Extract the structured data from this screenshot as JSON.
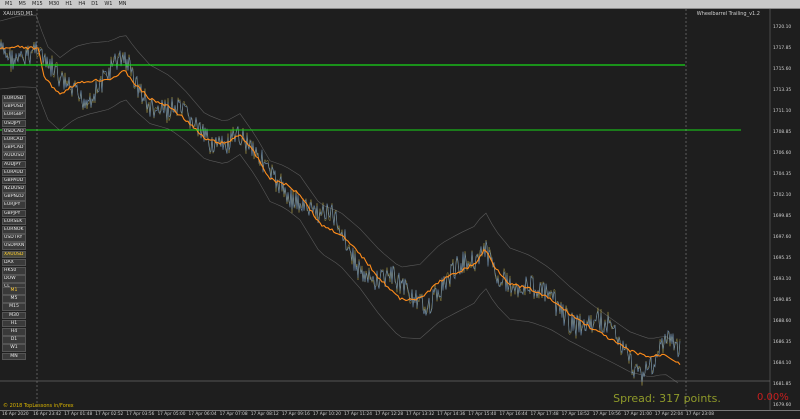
{
  "toolbar": {
    "timeframes": [
      "M1",
      "M5",
      "M15",
      "M30",
      "H1",
      "H4",
      "D1",
      "W1",
      "MN"
    ]
  },
  "chart": {
    "symbol_label": "XAUUSD,M1",
    "indicator_label": "Wheelbarrel Trailing_v1.2",
    "copyright": "© 2018 TopLessons in/Forex",
    "spread_text": "Spread: 317 points.",
    "spread_pct": "0.00%",
    "colors": {
      "background": "#1e1e1e",
      "price_line": "#6f8fb0",
      "price_line_alt": "#b8a84a",
      "trailing_line": "#ff8c1a",
      "band_line": "#5a5a5a",
      "level_line": "#18d818",
      "active_symbol": "#ffcc33"
    }
  },
  "symbols": [
    "EURUSD",
    "GBPUSD",
    "EURGBP",
    "USDJPY",
    "USDCAD",
    "EURCAD",
    "GBPCAD",
    "AUDUSD",
    "AUDJPY",
    "EURAUD",
    "GBPAUD",
    "NZDUSD",
    "GBPNZD",
    "EURJPY",
    "GBPJPY",
    "EURSEK",
    "EURNOK",
    "USDTRY",
    "USDMXN",
    "XAUUSD",
    "DAX",
    "HK50",
    "DOW",
    "CL",
    "NGAS"
  ],
  "active_symbol": "XAUUSD",
  "tf_list": [
    "M1",
    "M5",
    "M15",
    "M30",
    "H1",
    "H4",
    "D1",
    "W1",
    "MN"
  ],
  "active_tf": "M1",
  "price_axis": [
    "1720.10",
    "1717.85",
    "1715.60",
    "1713.35",
    "1711.10",
    "1708.85",
    "1706.60",
    "1704.35",
    "1702.10",
    "1699.85",
    "1697.60",
    "1695.35",
    "1693.10",
    "1690.85",
    "1688.60",
    "1686.35",
    "1684.10",
    "1681.85",
    "1679.60"
  ],
  "time_axis": [
    "16 Apr 2020",
    "16 Apr 23:42",
    "17 Apr 01:48",
    "17 Apr 02:52",
    "17 Apr 03:56",
    "17 Apr 05:00",
    "17 Apr 06:04",
    "17 Apr 07:08",
    "17 Apr 08:12",
    "17 Apr 09:16",
    "17 Apr 10:20",
    "17 Apr 11:24",
    "17 Apr 12:28",
    "17 Apr 13:32",
    "17 Apr 14:36",
    "17 Apr 15:40",
    "17 Apr 16:44",
    "17 Apr 17:48",
    "17 Apr 18:52",
    "17 Apr 19:56",
    "17 Apr 21:00",
    "17 Apr 22:04",
    "17 Apr 23:08"
  ]
}
